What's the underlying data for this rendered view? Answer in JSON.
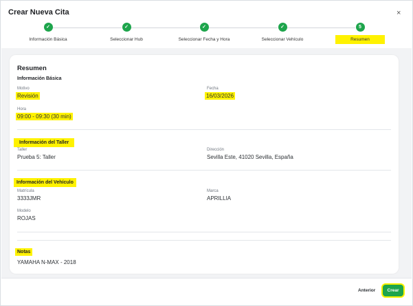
{
  "modal": {
    "title": "Crear Nueva Cita",
    "close_glyph": "×"
  },
  "stepper": {
    "steps": [
      {
        "label": "Información Básica",
        "status": "done"
      },
      {
        "label": "Seleccionar Hub",
        "status": "done"
      },
      {
        "label": "Seleccionar Fecha y Hora",
        "status": "done"
      },
      {
        "label": "Seleccionar Vehículo",
        "status": "done"
      },
      {
        "label": "Resumen",
        "status": "current",
        "number": "5"
      }
    ],
    "check_glyph": "✓",
    "accent": "#1ea54c",
    "highlight": "#fff200"
  },
  "summary": {
    "title": "Resumen",
    "basic": {
      "heading": "Información Básica",
      "motivo_label": "Motivo",
      "motivo_value": "Revisión",
      "fecha_label": "Fecha",
      "fecha_value": "16/03/2026",
      "hora_label": "Hora",
      "hora_value": "09:00 - 09:30 (30 min)"
    },
    "taller": {
      "heading": "Información del Taller",
      "taller_label": "Taller",
      "taller_value": "Prueba 5: Taller",
      "direccion_label": "Dirección",
      "direccion_value": "Sevilla Este, 41020 Sevilla, España"
    },
    "vehiculo": {
      "heading": "Información del Vehículo",
      "matricula_label": "Matrícula",
      "matricula_value": "3333JMR",
      "marca_label": "Marca",
      "marca_value": "APRILLIA",
      "modelo_label": "Modelo",
      "modelo_value": "ROJAS"
    },
    "notas": {
      "heading": "Notas",
      "value": "YAMAHA N-MAX - 2018"
    }
  },
  "footer": {
    "back_label": "Anterior",
    "create_label": "Crear"
  }
}
